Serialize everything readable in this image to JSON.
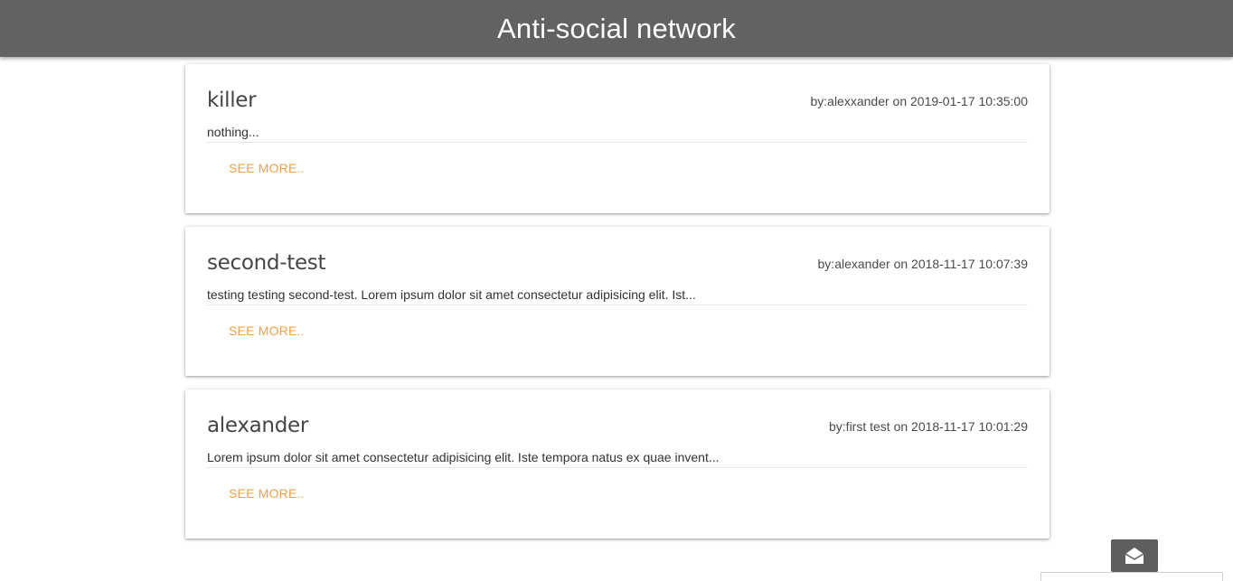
{
  "header": {
    "title": "Anti-social network"
  },
  "posts": [
    {
      "title": "killer",
      "meta": "by:alexxander on 2019-01-17 10:35:00",
      "excerpt": "nothing...",
      "see_more": "SEE MORE.."
    },
    {
      "title": "second-test",
      "meta": "by:alexander on 2018-11-17 10:07:39",
      "excerpt": "testing testing second-test. Lorem ipsum dolor sit amet consectetur adipisicing elit. Ist...",
      "see_more": "SEE MORE.."
    },
    {
      "title": "alexander",
      "meta": "by:first test on 2018-11-17 10:01:29",
      "excerpt": "Lorem ipsum dolor sit amet consectetur adipisicing elit. Iste tempora natus ex quae invent...",
      "see_more": "SEE MORE.."
    }
  ],
  "colors": {
    "header_bg": "#626262",
    "accent": "#f0a04a",
    "fab_bg": "#5e5e5e"
  },
  "icons": {
    "fab": "open-envelope-icon"
  }
}
